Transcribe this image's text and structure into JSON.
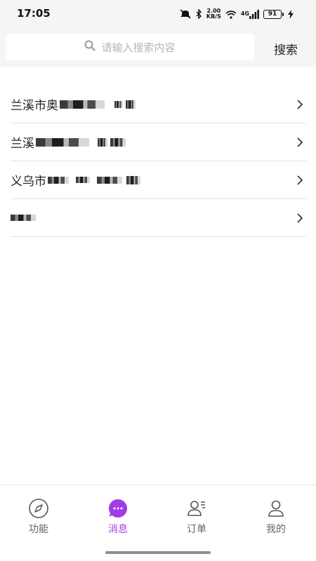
{
  "status_bar": {
    "time": "17:05",
    "net_speed_value": "2.00",
    "net_speed_unit": "KB/S",
    "network_type": "4G",
    "battery_level": "91",
    "icons": [
      "mute-icon",
      "bluetooth-icon",
      "wifi-icon",
      "signal-icon",
      "charging-icon"
    ]
  },
  "search": {
    "placeholder": "请输入搜索内容",
    "value": "",
    "button_label": "搜索"
  },
  "contacts": [
    {
      "label": "兰溪市奥"
    },
    {
      "label": "兰溪"
    },
    {
      "label": "义乌市"
    },
    {
      "label": ""
    }
  ],
  "tabs": [
    {
      "label": "功能",
      "icon": "compass-icon",
      "active": false
    },
    {
      "label": "消息",
      "icon": "chat-bubble-icon",
      "active": true
    },
    {
      "label": "订单",
      "icon": "order-user-icon",
      "active": false
    },
    {
      "label": "我的",
      "icon": "profile-icon",
      "active": false
    }
  ],
  "colors": {
    "accent": "#a23be6",
    "background": "#f5f5f5",
    "divider": "#e3e3e3"
  }
}
